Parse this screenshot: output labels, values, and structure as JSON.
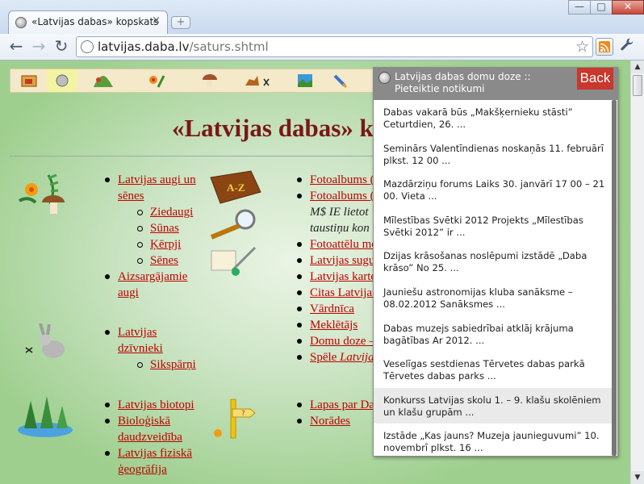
{
  "browser": {
    "tab_title": "«Latvijas dabas» kopskats",
    "tab_close": "×",
    "new_tab": "+",
    "url_host": "latvijas.daba.lv",
    "url_path": "/saturs.shtml",
    "back": "←",
    "forward": "→",
    "reload": "↻",
    "star": "☆",
    "wrench": "🔧",
    "minimize": "—",
    "maximize": "□",
    "close": "✕"
  },
  "page": {
    "heading": "«Latvijas dabas» k",
    "col1": {
      "group1": [
        {
          "text": "Latvijas augi un sēnes",
          "type": "link"
        },
        {
          "text": "Ziedaugi",
          "type": "sub"
        },
        {
          "text": "Sūnas",
          "type": "sub"
        },
        {
          "text": "Ķērpji",
          "type": "sub"
        },
        {
          "text": "Sēnes",
          "type": "sub"
        },
        {
          "text": "Aizsargājamie augi",
          "type": "link"
        }
      ],
      "group2": [
        {
          "text": "Latvijas dzīvnieki",
          "type": "link"
        },
        {
          "text": "Sikspārņi",
          "type": "sub"
        }
      ],
      "group3": [
        {
          "text": "Latvijas biotopi",
          "type": "link"
        },
        {
          "text": "Bioloģiskā daudzveidība",
          "type": "link"
        },
        {
          "text": "Latvijas fiziskā ģeogrāfija",
          "type": "link"
        }
      ]
    },
    "col2": {
      "items": [
        "Fotoalbums (",
        "Fotoalbums (",
        "Fotoattēlu me",
        "Latvijas sugu",
        "Latvijas karte",
        "Citas Latvijas",
        "Vārdnīca",
        "Meklētājs",
        "Domu doze –",
        "Spēle "
      ],
      "italic1": "M$ IE lietot",
      "italic2": "taustiņu kon",
      "spele_italic": "Latvija",
      "group2": [
        "Lapas par Da",
        "Norādes"
      ]
    }
  },
  "popup": {
    "title": "Latvijas dabas domu doze :: Pieteiktie notikumi",
    "back_label": "Back",
    "items": [
      "Dabas vakarā būs „Makšķernieku stāsti” Ceturtdien, 26. ...",
      "Seminārs Valentīndienas noskaņās 11. februārī plkst. 12 00 ...",
      "Mazdārziņu forums Laiks 30. janvārī 17 00 – 21 00. Vieta ...",
      "Mīlestības Svētki 2012 Projekts „Mīlestības Svētki 2012” ir ...",
      "Dzijas krāsošanas noslēpumi izstādē „Daba krāso” No 25. ...",
      "Jauniešu astronomijas kluba sanāksme – 08.02.2012 Sanāksmes ...",
      "Dabas muzejs sabiedrībai atklāj krājuma bagātības Ar 2012. ...",
      "Veselīgas sestdienas Tērvetes dabas parkā Tērvetes dabas parks ...",
      "Konkurss Latvijas skolu 1. – 9. klašu skolēniem un klašu grupām ...",
      "Izstāde „Kas jauns? Muzeja jaunieguvumi” 10. novembrī plkst. 16 ..."
    ]
  },
  "colors": {
    "heading": "#7a1717",
    "link": "#c00000",
    "back_button": "#c9372d",
    "popup_header": "#8a8a8a"
  }
}
